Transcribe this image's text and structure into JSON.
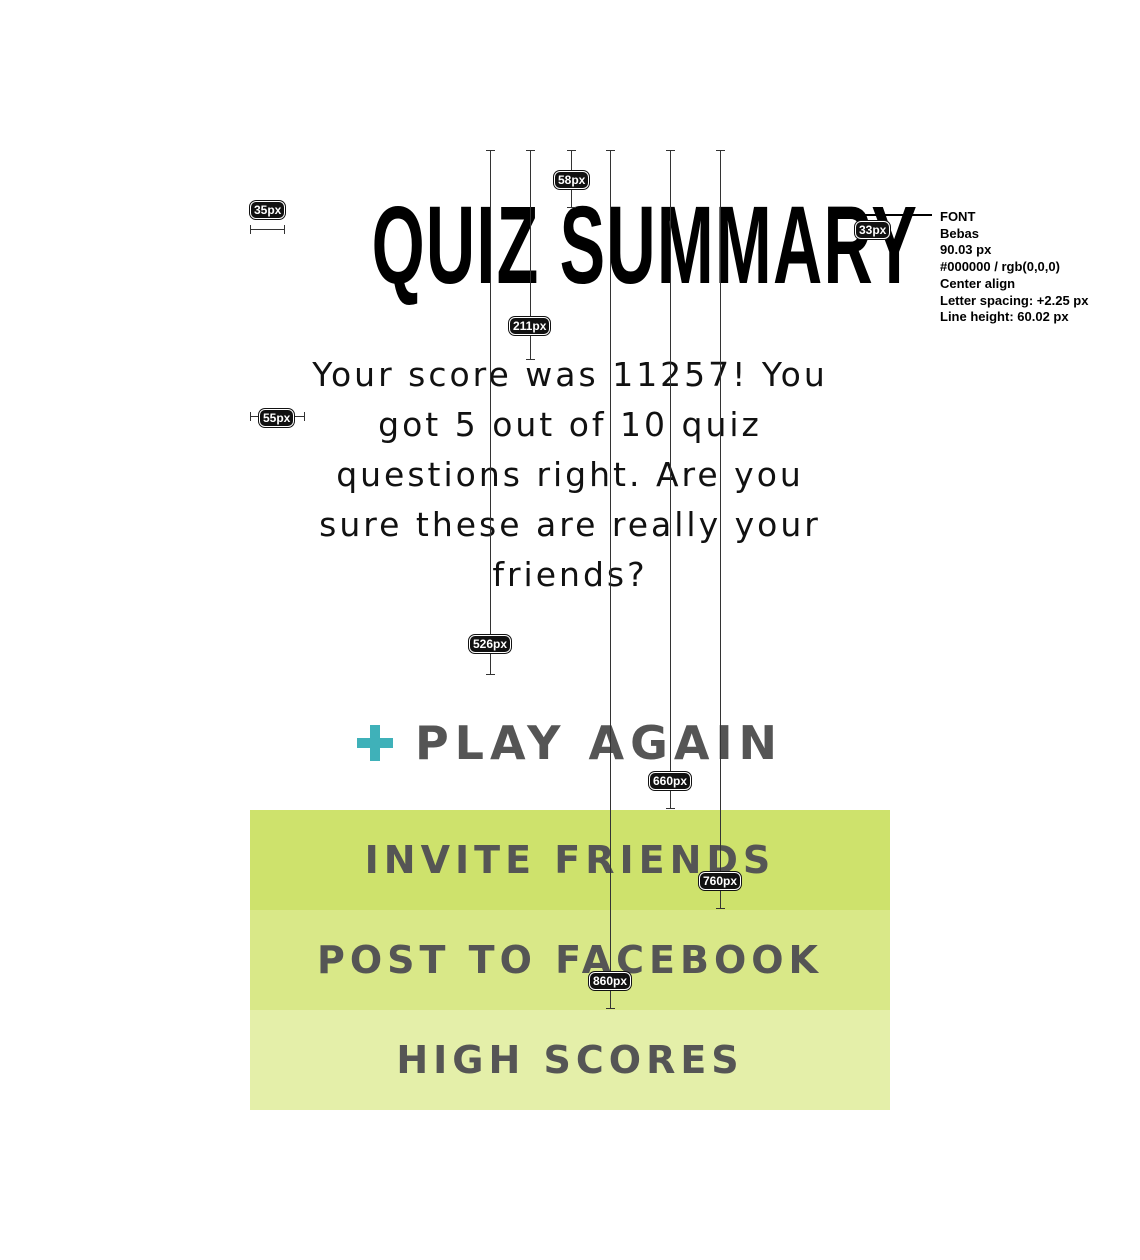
{
  "screen": {
    "title": "QUIZ SUMMARY",
    "summary_text": "Your score was 11257! You got 5 out of 10 quiz questions right. Are you sure these are really your friends?",
    "play_again": {
      "icon": "plus-icon",
      "label": "PLAY AGAIN",
      "icon_color": "#3fb1b9"
    },
    "buttons": [
      {
        "label": "INVITE FRIENDS",
        "color": "#cee26c"
      },
      {
        "label": "POST TO FACEBOOK",
        "color": "#d9e888"
      },
      {
        "label": "HIGH SCORES",
        "color": "#e4efa9"
      }
    ],
    "text_color": "#555555"
  },
  "spec": {
    "measurements": [
      "35px",
      "33px",
      "58px",
      "211px",
      "55px",
      "526px",
      "660px",
      "760px",
      "860px"
    ],
    "font_note": [
      "FONT",
      "Bebas",
      "90.03 px",
      "#000000 / rgb(0,0,0)",
      "Center align",
      "Letter spacing: +2.25 px",
      "Line height: 60.02 px"
    ]
  }
}
